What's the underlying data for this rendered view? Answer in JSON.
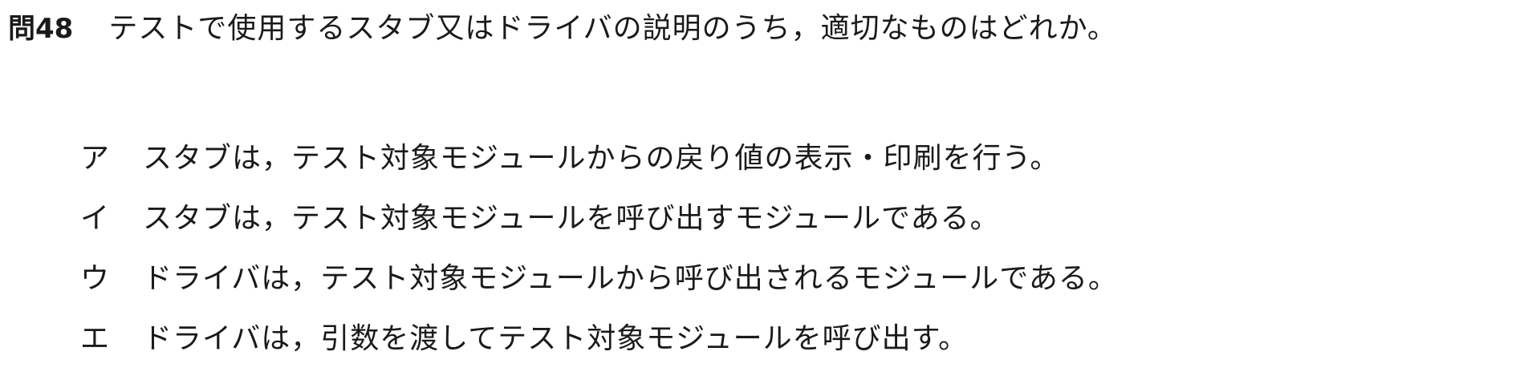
{
  "question": {
    "number": "問48",
    "text": "テストで使用するスタブ又はドライバの説明のうち，適切なものはどれか。"
  },
  "options": [
    {
      "label": "ア",
      "text": "スタブは，テスト対象モジュールからの戻り値の表示・印刷を行う。"
    },
    {
      "label": "イ",
      "text": "スタブは，テスト対象モジュールを呼び出すモジュールである。"
    },
    {
      "label": "ウ",
      "text": "ドライバは，テスト対象モジュールから呼び出されるモジュールである。"
    },
    {
      "label": "エ",
      "text": "ドライバは，引数を渡してテスト対象モジュールを呼び出す。"
    }
  ]
}
